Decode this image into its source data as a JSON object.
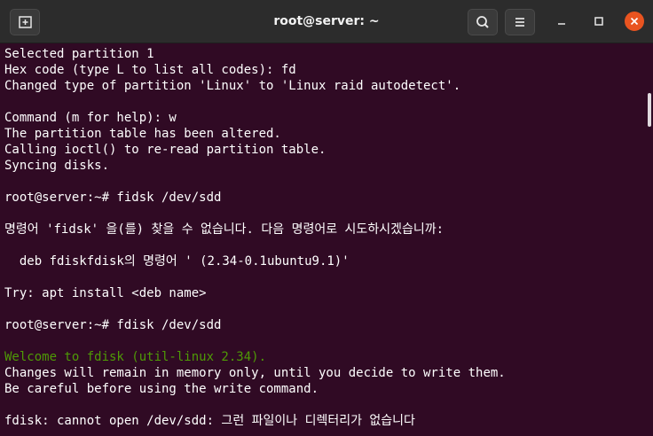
{
  "window": {
    "title": "root@server: ~",
    "icons": {
      "new_tab": "new-tab-icon",
      "search": "search-icon",
      "menu": "hamburger-menu-icon",
      "minimize": "minimize-icon",
      "maximize": "maximize-icon",
      "close": "close-icon"
    }
  },
  "terminal": {
    "lines": [
      "Selected partition 1",
      "Hex code (type L to list all codes): fd",
      "Changed type of partition 'Linux' to 'Linux raid autodetect'.",
      "",
      "Command (m for help): w",
      "The partition table has been altered.",
      "Calling ioctl() to re-read partition table.",
      "Syncing disks.",
      "",
      "root@server:~# fidsk /dev/sdd",
      "",
      "명령어 'fidsk' 을(를) 찾을 수 없습니다. 다음 명령어로 시도하시겠습니까:",
      "",
      "  deb fdiskfdisk의 명령어 ' (2.34-0.1ubuntu9.1)'",
      "",
      "Try: apt install <deb name>",
      "",
      "root@server:~# fdisk /dev/sdd",
      "",
      "Welcome to fdisk (util-linux 2.34).",
      "Changes will remain in memory only, until you decide to write them.",
      "Be careful before using the write command.",
      "",
      "fdisk: cannot open /dev/sdd: 그런 파일이나 디렉터리가 없습니다"
    ]
  },
  "colors": {
    "background": "#300a24",
    "titlebar": "#2c2c2c",
    "text": "#ffffff",
    "green_text": "#4e9a06",
    "close_button": "#e95420"
  }
}
